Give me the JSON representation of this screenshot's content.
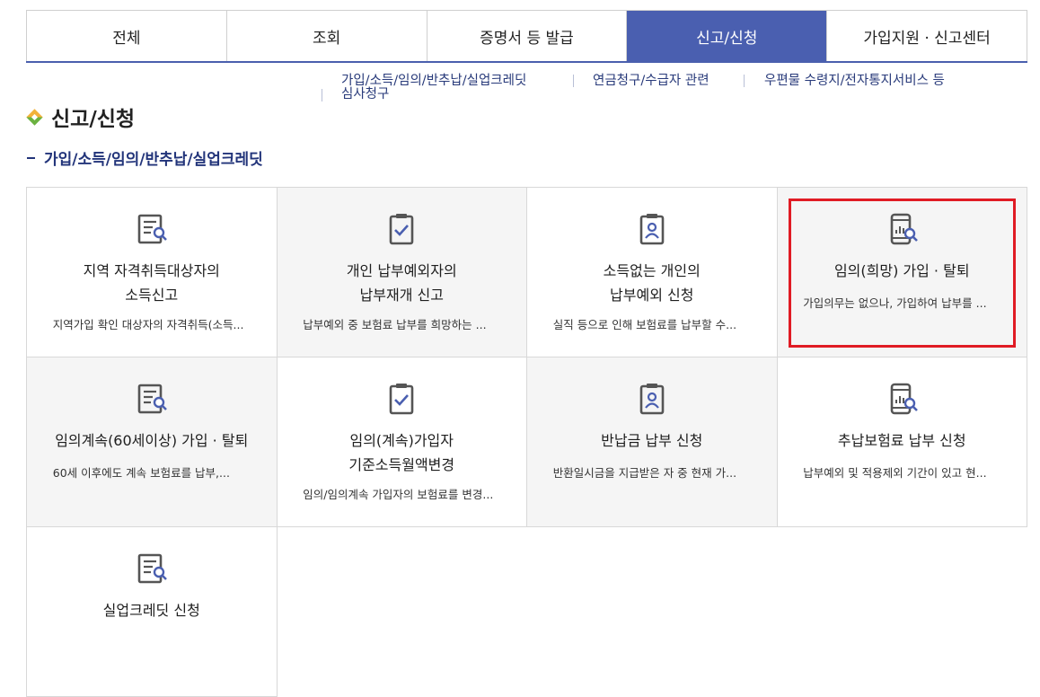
{
  "tabs": [
    {
      "label": "전체",
      "active": false
    },
    {
      "label": "조회",
      "active": false
    },
    {
      "label": "증명서 등 발급",
      "active": false
    },
    {
      "label": "신고/신청",
      "active": true
    },
    {
      "label": "가입지원 · 신고센터",
      "active": false
    }
  ],
  "sublinks": [
    "가입/소득/임의/반추납/실업크레딧",
    "연금청구/수급자 관련",
    "우편물 수령지/전자통지서비스 등",
    "심사청구"
  ],
  "page_title": "신고/신청",
  "section_title": "가입/소득/임의/반추납/실업크레딧",
  "colors": {
    "accent": "#4a5fb0",
    "highlight": "#e01b24",
    "icon": "#4a5fb0"
  },
  "cards": [
    {
      "icon": "document-search-icon",
      "title": "지역 자격취득대상자의\n소득신고",
      "desc": "지역가입 확인 대상자의 자격취득(소득..."
    },
    {
      "icon": "clipboard-check-icon",
      "title": "개인 납부예외자의\n납부재개 신고",
      "desc": "납부예외 중 보험료 납부를 희망하는 ..."
    },
    {
      "icon": "clipboard-person-icon",
      "title": "소득없는 개인의\n납부예외 신청",
      "desc": "실직 등으로 인해 보험료를 납부할 수..."
    },
    {
      "icon": "phone-search-icon",
      "title": "임의(희망) 가입 · 탈퇴",
      "desc": "가입의무는 없으나, 가입하여 납부를 ..."
    },
    {
      "icon": "document-search-icon",
      "title": "임의계속(60세이상) 가입 · 탈퇴",
      "desc": "60세 이후에도 계속 보험료를 납부,..."
    },
    {
      "icon": "clipboard-check-icon",
      "title": "임의(계속)가입자\n기준소득월액변경",
      "desc": "임의/임의계속 가입자의 보험료를 변경..."
    },
    {
      "icon": "clipboard-person-icon",
      "title": "반납금 납부 신청",
      "desc": "반환일시금을 지급받은 자 중 현재 가..."
    },
    {
      "icon": "phone-search-icon",
      "title": "추납보험료 납부 신청",
      "desc": "납부예외 및 적용제외 기간이 있고 현..."
    },
    {
      "icon": "document-search-icon",
      "title": "실업크레딧 신청",
      "desc": ""
    }
  ]
}
